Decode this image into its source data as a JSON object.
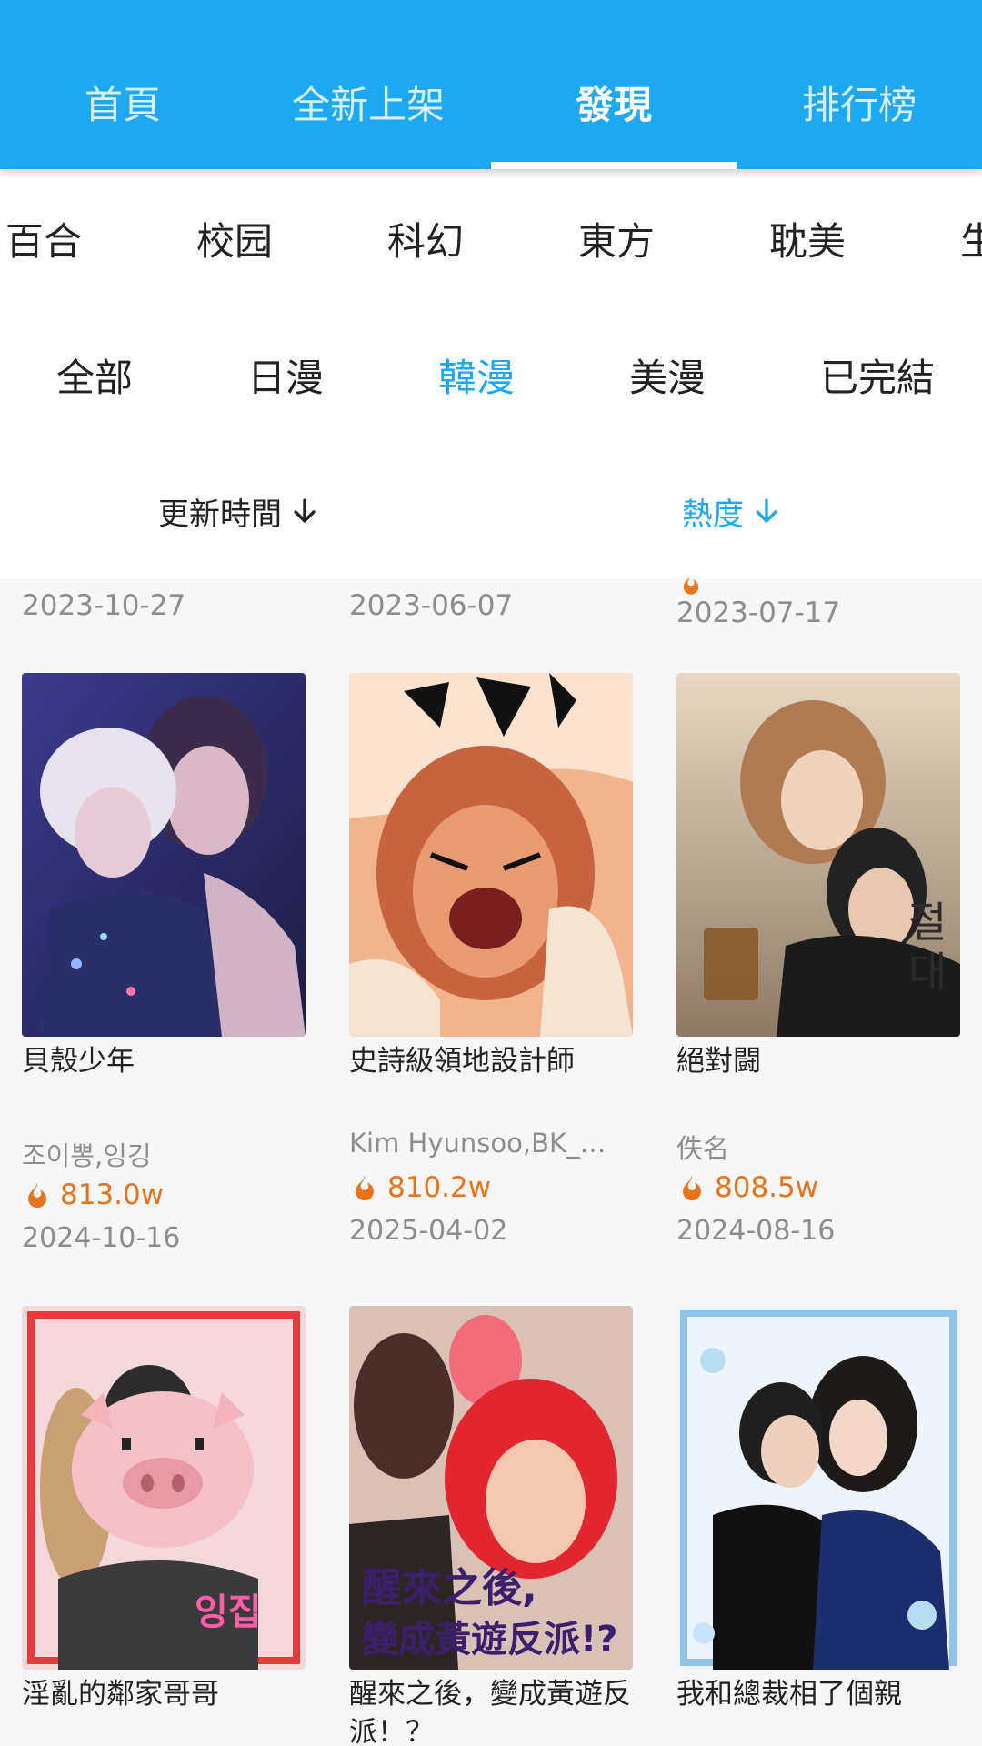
{
  "top_tabs": [
    {
      "label": "首頁"
    },
    {
      "label": "全新上架"
    },
    {
      "label": "發現",
      "active": true
    },
    {
      "label": "排行榜"
    }
  ],
  "genres": [
    "百合",
    "校园",
    "科幻",
    "東方",
    "耽美",
    "生"
  ],
  "regions": [
    {
      "label": "全部"
    },
    {
      "label": "日漫"
    },
    {
      "label": "韓漫",
      "active": true
    },
    {
      "label": "美漫"
    },
    {
      "label": "已完結"
    }
  ],
  "sorts": [
    {
      "label": "更新時間"
    },
    {
      "label": "熱度",
      "active": true
    }
  ],
  "prev_row_dates": [
    "2023-10-27",
    "2023-06-07",
    "2023-07-17"
  ],
  "cards": [
    {
      "title": "貝殼少年",
      "author": "조이뽕,잉깅",
      "heat": "813.0w",
      "date": "2024-10-16"
    },
    {
      "title": "史詩級領地設計師",
      "author": "Kim Hyunsoo,BK_…",
      "heat": "810.2w",
      "date": "2025-04-02"
    },
    {
      "title": "絕對闘",
      "author": "佚名",
      "heat": "808.5w",
      "date": "2024-08-16"
    },
    {
      "title": "淫亂的鄰家哥哥"
    },
    {
      "title": "醒來之後，變成黃遊反派！？"
    },
    {
      "title": "我和總裁相了個親"
    }
  ],
  "colors": {
    "accent": "#1ea8f2",
    "heat": "#e8731b",
    "muted": "#8d8d8d"
  },
  "icons": {
    "flame": "flame-icon",
    "sort": "arrow-down-icon"
  }
}
